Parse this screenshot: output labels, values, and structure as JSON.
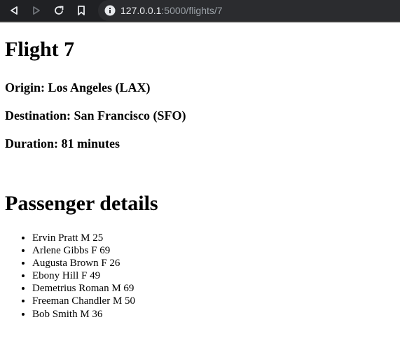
{
  "browser": {
    "url_host": "127.0.0.1",
    "url_rest": ":5000/flights/7",
    "icons": [
      "back-icon",
      "forward-icon",
      "reload-icon",
      "bookmark-icon",
      "info-icon"
    ]
  },
  "flight": {
    "title": "Flight 7",
    "origin": "Origin: Los Angeles (LAX)",
    "destination": "Destination: San Francisco (SFO)",
    "duration": "Duration: 81 minutes"
  },
  "passengers": {
    "title": "Passenger details",
    "items": [
      "Ervin Pratt M 25",
      "Arlene Gibbs F 69",
      "Augusta Brown F 26",
      "Ebony Hill F 49",
      "Demetrius Roman M 69",
      "Freeman Chandler M 50",
      "Bob Smith M 36"
    ]
  }
}
